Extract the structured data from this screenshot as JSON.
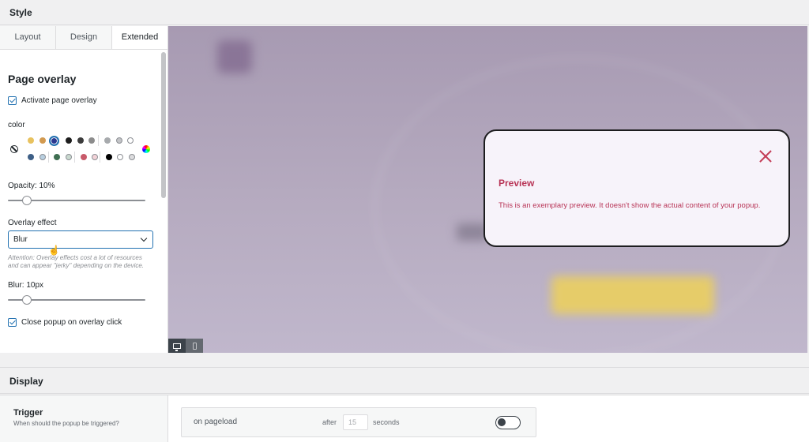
{
  "style_section": {
    "title": "Style"
  },
  "tabs": [
    {
      "label": "Layout",
      "active": false
    },
    {
      "label": "Design",
      "active": false
    },
    {
      "label": "Extended",
      "active": true
    }
  ],
  "panel": {
    "title": "Page overlay",
    "activate_overlay": {
      "label": "Activate page overlay",
      "checked": true
    },
    "color_label": "color",
    "color_swatches_row1": [
      "#e8c25f",
      "#d29a50",
      "#2b3790",
      "#1d1d1d",
      "#3c3c3c",
      "#8c8c8c",
      "#a7aaad",
      "#c3c4c7",
      "#ffffff"
    ],
    "color_swatches_row2": [
      "#3e5f86",
      "#b8cfe0",
      "#3f6f52",
      "#c9d9cf",
      "#c85a6a",
      "#f2d2d7",
      "#000000",
      "#ffffff",
      "#dcdcde"
    ],
    "selected_color": "#2b3790",
    "opacity_label": "Opacity: 10%",
    "opacity_value": 10,
    "overlay_effect_label": "Overlay effect",
    "overlay_effect_value": "Blur",
    "attention_text": "Attention: Overlay effects cost a lot of resources and can appear \"jerky\" depending on the device.",
    "blur_label": "Blur: 10px",
    "blur_value": 10,
    "close_on_click": {
      "label": "Close popup on overlay click",
      "checked": true
    }
  },
  "preview": {
    "popup_title": "Preview",
    "popup_text": "This is an exemplary preview. It doesn't show the actual content of your popup.",
    "accent": "#b83456",
    "device_buttons": [
      {
        "icon": "monitor-icon",
        "active": true
      },
      {
        "icon": "phone-icon",
        "active": false
      }
    ]
  },
  "display_section": {
    "title": "Display",
    "trigger_title": "Trigger",
    "trigger_subtitle": "When should the popup be triggered?",
    "trigger_option": "on pageload",
    "after_label": "after",
    "after_placeholder": "15",
    "seconds_label": "seconds",
    "toggle_on": false
  }
}
